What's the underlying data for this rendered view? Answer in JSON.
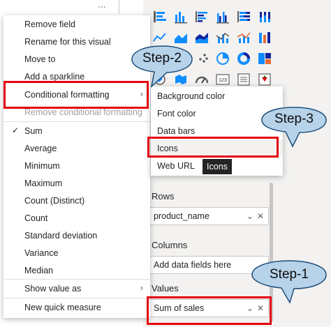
{
  "context_menu": {
    "items": [
      {
        "label": "Remove field"
      },
      {
        "label": "Rename for this visual"
      },
      {
        "label": "Move to"
      },
      {
        "label": "Add a sparkline"
      },
      {
        "label": "Conditional formatting"
      },
      {
        "label": "Remove conditional formatting"
      },
      {
        "label": "Sum"
      },
      {
        "label": "Average"
      },
      {
        "label": "Minimum"
      },
      {
        "label": "Maximum"
      },
      {
        "label": "Count (Distinct)"
      },
      {
        "label": "Count"
      },
      {
        "label": "Standard deviation"
      },
      {
        "label": "Variance"
      },
      {
        "label": "Median"
      },
      {
        "label": "Show value as"
      },
      {
        "label": "New quick measure"
      }
    ],
    "checked_item": "Sum"
  },
  "conditional_formatting_submenu": {
    "items": [
      {
        "label": "Background color"
      },
      {
        "label": "Font color"
      },
      {
        "label": "Data bars"
      },
      {
        "label": "Icons"
      },
      {
        "label": "Web URL"
      }
    ],
    "tooltip": "Icons"
  },
  "fields_pane": {
    "rows_label": "Rows",
    "rows_field": "product_name",
    "columns_label": "Columns",
    "columns_placeholder": "Add data fields here",
    "values_label": "Values",
    "values_field": "Sum of sales"
  },
  "callouts": {
    "step1": "Step-1",
    "step2": "Step-2",
    "step3": "Step-3"
  },
  "colors": {
    "highlight_red": "#e3000f",
    "callout_fill": "#b7d3ea",
    "callout_stroke": "#1f4e79"
  }
}
